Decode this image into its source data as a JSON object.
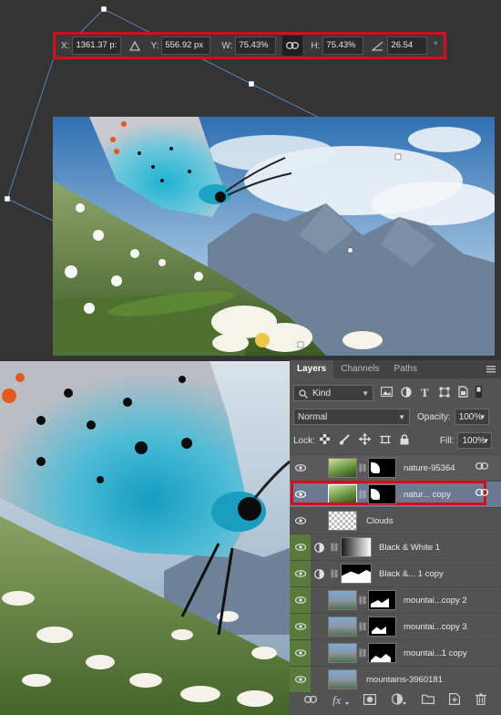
{
  "transform_options": {
    "x_label": "X:",
    "x_value": "1361.37 p:",
    "y_label": "Y:",
    "y_value": "556.92 px",
    "w_label": "W:",
    "w_value": "75.43%",
    "h_label": "H:",
    "h_value": "75.43%",
    "angle_value": "26.54",
    "angle_unit": "°"
  },
  "panel": {
    "tabs": [
      {
        "label": "Layers",
        "active": true
      },
      {
        "label": "Channels",
        "active": false
      },
      {
        "label": "Paths",
        "active": false
      }
    ],
    "filter_kind": "Kind",
    "blend_mode": "Normal",
    "opacity_label": "Opacity:",
    "opacity_value": "100%",
    "lock_label": "Lock:",
    "fill_label": "Fill:",
    "fill_value": "100%"
  },
  "layers": [
    {
      "name": "nature-95364",
      "icon": "eye-icon",
      "selected": false
    },
    {
      "name": "natur... copy",
      "icon": "eye-icon",
      "selected": true
    },
    {
      "name": "Clouds",
      "icon": "eye-icon",
      "selected": false
    },
    {
      "name": "Black & White 1",
      "icon": "eye-icon",
      "selected": false
    },
    {
      "name": "Black &... 1 copy",
      "icon": "eye-icon",
      "selected": false
    },
    {
      "name": "mountai...copy 2",
      "icon": "eye-icon",
      "selected": false
    },
    {
      "name": "mountai...copy 3",
      "icon": "eye-icon",
      "selected": false
    },
    {
      "name": "mountai...1 copy",
      "icon": "eye-icon",
      "selected": false
    },
    {
      "name": "mountains-3960181",
      "icon": "eye-icon",
      "selected": false
    }
  ],
  "colors": {
    "highlight_red": "#d0101b",
    "panel_bg": "#535353",
    "eye_green": "#5a7a3c"
  }
}
